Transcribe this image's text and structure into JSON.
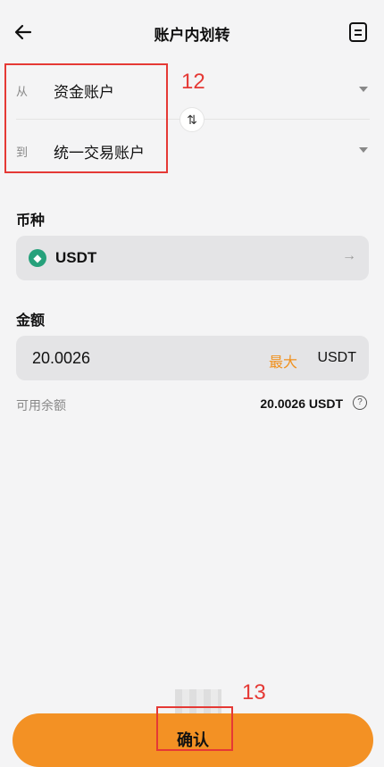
{
  "header": {
    "title": "账户内划转"
  },
  "transfer": {
    "from_label": "从",
    "from_account": "资金账户",
    "to_label": "到",
    "to_account": "统一交易账户"
  },
  "coin": {
    "section_label": "币种",
    "selected": "USDT"
  },
  "amount": {
    "section_label": "金额",
    "value": "20.0026",
    "max_label": "最大",
    "unit": "USDT"
  },
  "available": {
    "label": "可用余额",
    "value": "20.0026 USDT"
  },
  "confirm_label": "确认",
  "annotations": {
    "a1": "12",
    "a2": "13"
  },
  "colors": {
    "accent": "#f39124",
    "annotation": "#e53935",
    "tether": "#26a17b"
  }
}
